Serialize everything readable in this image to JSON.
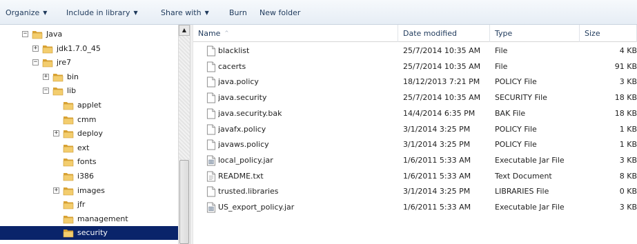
{
  "toolbar": {
    "organize": "Organize",
    "include_in_library": "Include in library",
    "share_with": "Share with",
    "burn": "Burn",
    "new_folder": "New folder"
  },
  "tree": [
    {
      "label": "Java",
      "expander": "−",
      "level": 0
    },
    {
      "label": "jdk1.7.0_45",
      "expander": "+",
      "level": 1
    },
    {
      "label": "jre7",
      "expander": "−",
      "level": 1
    },
    {
      "label": "bin",
      "expander": "+",
      "level": 2
    },
    {
      "label": "lib",
      "expander": "−",
      "level": 2
    },
    {
      "label": "applet",
      "expander": "",
      "level": 3
    },
    {
      "label": "cmm",
      "expander": "",
      "level": 3
    },
    {
      "label": "deploy",
      "expander": "+",
      "level": 3
    },
    {
      "label": "ext",
      "expander": "",
      "level": 3
    },
    {
      "label": "fonts",
      "expander": "",
      "level": 3
    },
    {
      "label": "i386",
      "expander": "",
      "level": 3
    },
    {
      "label": "images",
      "expander": "+",
      "level": 3
    },
    {
      "label": "jfr",
      "expander": "",
      "level": 3
    },
    {
      "label": "management",
      "expander": "",
      "level": 3
    },
    {
      "label": "security",
      "expander": "",
      "level": 3,
      "selected": true
    }
  ],
  "columns": {
    "name": "Name",
    "date_modified": "Date modified",
    "type": "Type",
    "size": "Size"
  },
  "files": [
    {
      "name": "blacklist",
      "date": "25/7/2014 10:35 AM",
      "type": "File",
      "size": "4 KB",
      "icon": "blank-file-icon"
    },
    {
      "name": "cacerts",
      "date": "25/7/2014 10:35 AM",
      "type": "File",
      "size": "91 KB",
      "icon": "blank-file-icon"
    },
    {
      "name": "java.policy",
      "date": "18/12/2013 7:21 PM",
      "type": "POLICY File",
      "size": "3 KB",
      "icon": "blank-file-icon"
    },
    {
      "name": "java.security",
      "date": "25/7/2014 10:35 AM",
      "type": "SECURITY File",
      "size": "18 KB",
      "icon": "blank-file-icon"
    },
    {
      "name": "java.security.bak",
      "date": "14/4/2014 6:35 PM",
      "type": "BAK File",
      "size": "18 KB",
      "icon": "blank-file-icon"
    },
    {
      "name": "javafx.policy",
      "date": "3/1/2014 3:25 PM",
      "type": "POLICY File",
      "size": "1 KB",
      "icon": "blank-file-icon"
    },
    {
      "name": "javaws.policy",
      "date": "3/1/2014 3:25 PM",
      "type": "POLICY File",
      "size": "1 KB",
      "icon": "blank-file-icon"
    },
    {
      "name": "local_policy.jar",
      "date": "1/6/2011 5:33 AM",
      "type": "Executable Jar File",
      "size": "3 KB",
      "icon": "jar-file-icon"
    },
    {
      "name": "README.txt",
      "date": "1/6/2011 5:33 AM",
      "type": "Text Document",
      "size": "8 KB",
      "icon": "text-file-icon"
    },
    {
      "name": "trusted.libraries",
      "date": "3/1/2014 3:25 PM",
      "type": "LIBRARIES File",
      "size": "0 KB",
      "icon": "blank-file-icon"
    },
    {
      "name": "US_export_policy.jar",
      "date": "1/6/2011 5:33 AM",
      "type": "Executable Jar File",
      "size": "3 KB",
      "icon": "jar-file-icon"
    }
  ],
  "colors": {
    "selection": "#0a246a",
    "folder": "#e8b84a",
    "toolbar_text": "#1e395b"
  }
}
